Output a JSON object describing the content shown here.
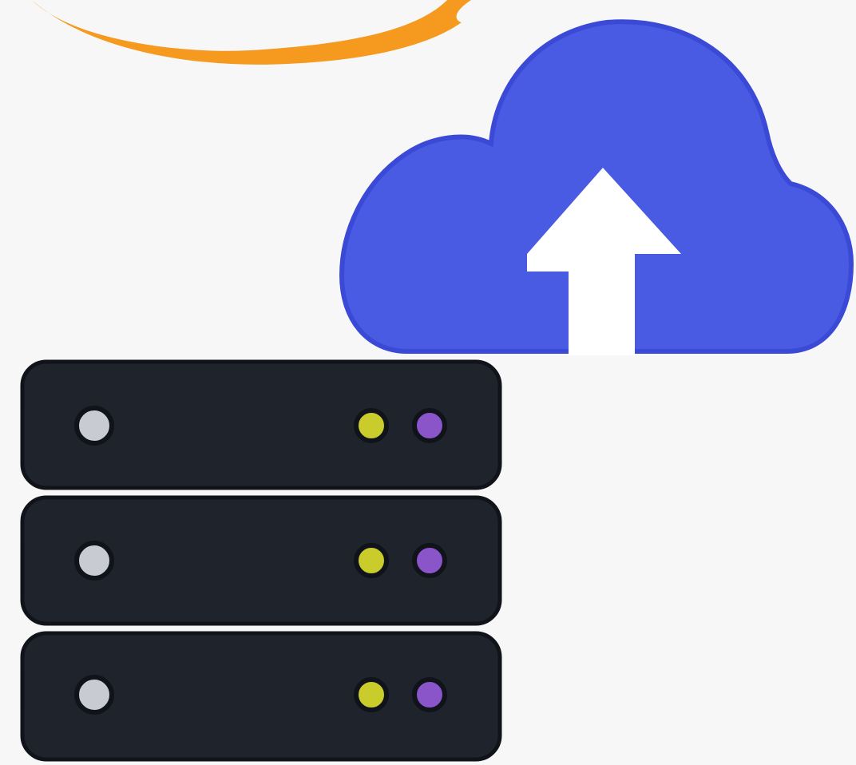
{
  "icons": {
    "swoosh": "orange-swoosh-icon",
    "cloud": "cloud-upload-icon",
    "arrow": "up-arrow-icon",
    "server": "server-rack-icon"
  },
  "colors": {
    "background": "#f7f7f8",
    "swoosh": "#f59a1f",
    "cloud": "#4a5be3",
    "cloud_edge": "#3b4ad6",
    "arrow": "#ffffff",
    "server_body": "#1f232c",
    "server_edge": "#101319",
    "led_power": "#c9cbd2",
    "led_yellow": "#c9cc2a",
    "led_purple": "#8a55c9"
  },
  "server": {
    "unit_count": 3
  }
}
